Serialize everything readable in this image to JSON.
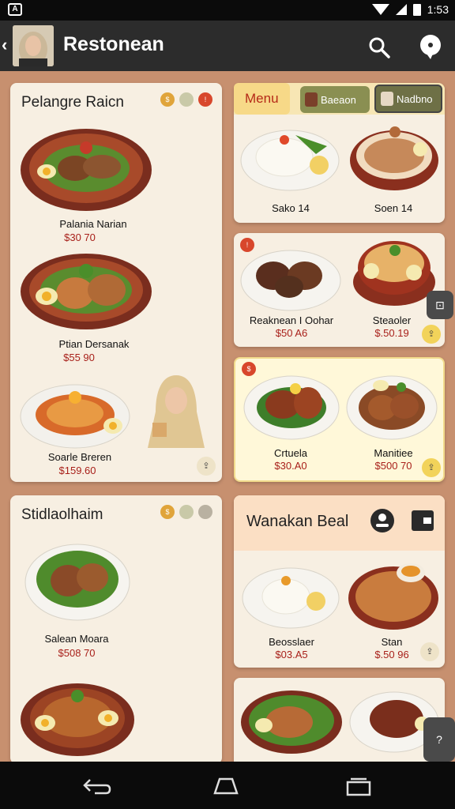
{
  "status": {
    "time": "1:53"
  },
  "appbar": {
    "title": "Restonean"
  },
  "left": {
    "card1": {
      "title": "Pelangre Raicn",
      "items": [
        {
          "name": "Palania Narian",
          "price": "$30 70"
        },
        {
          "name": "Ptian Dersanak",
          "price": "$55 90"
        },
        {
          "name": "Soarle Breren",
          "price": "$159.60"
        }
      ]
    },
    "card2": {
      "title": "Stidlaolhaim",
      "items": [
        {
          "name": "Salean Moara",
          "price": "$508 70"
        },
        {
          "name": "",
          "price": ""
        }
      ]
    }
  },
  "right": {
    "tabs": {
      "menu": "Menu",
      "t2": "Baeaon",
      "t3": "Nadbno"
    },
    "card1": {
      "items": [
        {
          "name": "Sako 14",
          "price": ""
        },
        {
          "name": "Soen 14",
          "price": ""
        }
      ]
    },
    "card2": {
      "items": [
        {
          "name": "Reaknean I Oohar",
          "price": "$50 A6"
        },
        {
          "name": "Steaoler",
          "price": "$.50.19"
        }
      ]
    },
    "card3": {
      "items": [
        {
          "name": "Crtuela",
          "price": "$30.A0"
        },
        {
          "name": "Manitiee",
          "price": "$500 70"
        }
      ]
    },
    "card4": {
      "title": "Wanakan Beal",
      "items": [
        {
          "name": "Beosslaer",
          "price": "$03.A5"
        },
        {
          "name": "Stan",
          "price": "$.50 96"
        }
      ]
    }
  },
  "colors": {
    "accent": "#a8201a",
    "cardBg": "#f7efe2",
    "highlightCardBg": "#fff8d9",
    "page": "#c7906f"
  }
}
